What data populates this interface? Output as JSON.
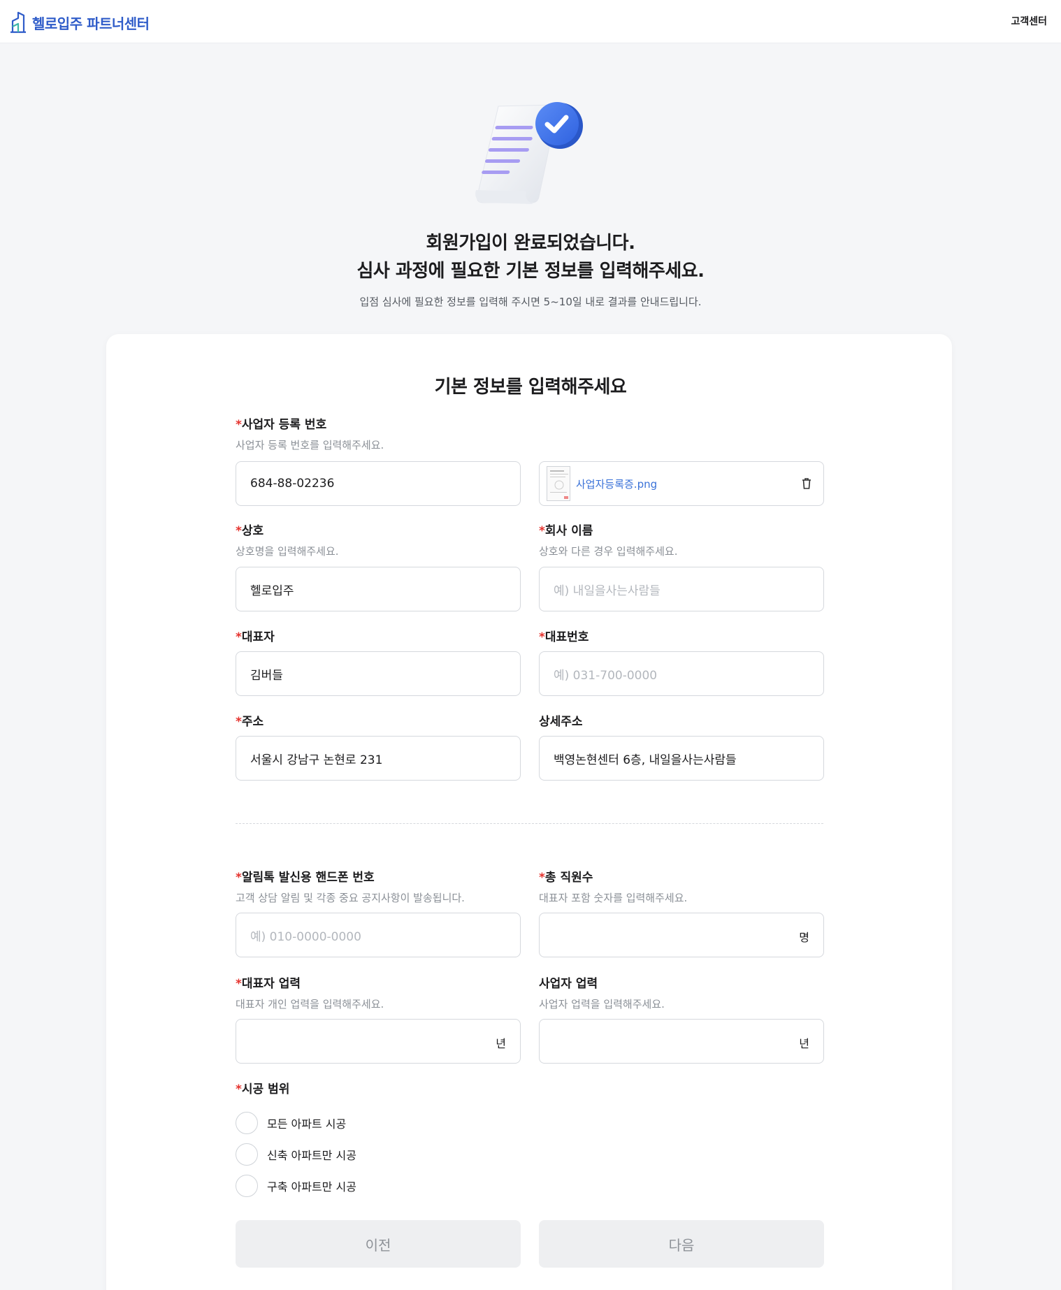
{
  "header": {
    "logo_text": "헬로입주 파트너센터",
    "support_label": "고객센터"
  },
  "hero": {
    "title_line1": "회원가입이 완료되었습니다.",
    "title_line2": "심사 과정에 필요한 기본 정보를 입력해주세요.",
    "subtitle": "입점 심사에 필요한 정보를 입력해 주시면 5~10일 내로 결과를 안내드립니다."
  },
  "form": {
    "title": "기본 정보를 입력해주세요",
    "required_mark": "*",
    "business_number": {
      "label": "사업자 등록 번호",
      "help": "사업자 등록 번호를 입력해주세요.",
      "value": "684-88-02236",
      "file_name": "사업자등록증.png"
    },
    "trade_name": {
      "label": "상호",
      "help": "상호명을 입력해주세요.",
      "value": "헬로입주"
    },
    "company_name": {
      "label": "회사 이름",
      "help": "상호와 다른 경우 입력해주세요.",
      "placeholder": "예) 내일을사는사람들"
    },
    "ceo": {
      "label": "대표자",
      "value": "김버들"
    },
    "main_phone": {
      "label": "대표번호",
      "placeholder": "예) 031-700-0000"
    },
    "address": {
      "label": "주소",
      "value": "서울시 강남구 논현로 231"
    },
    "address_detail": {
      "label": "상세주소",
      "value": "백영논현센터 6층, 내일을사는사람들"
    },
    "alimtalk_phone": {
      "label": "알림톡 발신용 핸드폰 번호",
      "help": "고객 상담 알림 및 각종 중요 공지사항이 발송됩니다.",
      "placeholder": "예) 010-0000-0000"
    },
    "employees": {
      "label": "총 직원수",
      "help": "대표자 포함 숫자를 입력해주세요.",
      "unit": "명"
    },
    "ceo_career": {
      "label": "대표자 업력",
      "help": "대표자 개인 업력을 입력해주세요.",
      "unit": "년"
    },
    "business_career": {
      "label": "사업자 업력",
      "help": "사업자 업력을 입력해주세요.",
      "unit": "년"
    },
    "scope": {
      "label": "시공 범위",
      "options": [
        "모든 아파트 시공",
        "신축 아파트만 시공",
        "구축 아파트만 시공"
      ]
    },
    "buttons": {
      "prev": "이전",
      "next": "다음"
    }
  },
  "icons": {
    "logo": "building-logo-icon",
    "file_preview": "document-thumbnail-icon",
    "delete": "trash-icon",
    "hero": "document-check-illustration"
  },
  "colors": {
    "brand": "#2f5cc9",
    "required": "#e5322d",
    "link": "#3a72d8"
  }
}
